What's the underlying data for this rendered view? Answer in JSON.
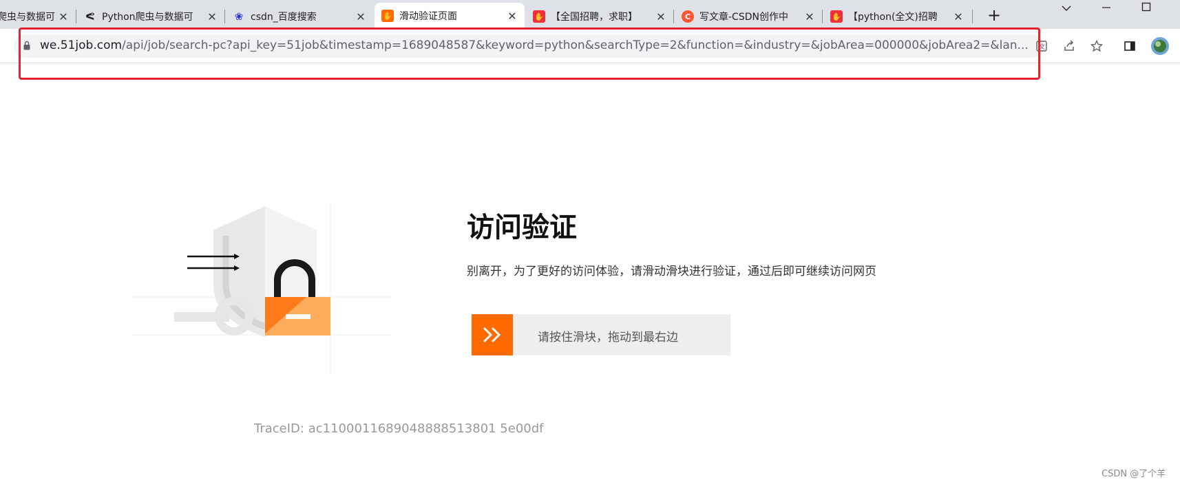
{
  "browser": {
    "tabs": [
      {
        "title": "爬虫与数据可",
        "icon": "app-icon",
        "active": false
      },
      {
        "title": "Python爬虫与数据可",
        "icon": "python-icon",
        "active": false
      },
      {
        "title": "csdn_百度搜索",
        "icon": "baidu-paw-icon",
        "active": false
      },
      {
        "title": "滑动验证页面",
        "icon": "hand-icon",
        "active": true
      },
      {
        "title": "【全国招聘，求职】",
        "icon": "51job-icon",
        "active": false
      },
      {
        "title": "写文章-CSDN创作中",
        "icon": "csdn-icon",
        "active": false
      },
      {
        "title": "【python(全文)招聘",
        "icon": "51job-icon",
        "active": false
      }
    ],
    "new_tab": "+",
    "close_glyph": "✕",
    "url_host": "we.51job.com",
    "url_path": "/api/job/search-pc?api_key=51job&timestamp=1689048587&keyword=python&searchType=2&function=&industry=&jobArea=000000&jobArea2=&lan..."
  },
  "page": {
    "title": "访问验证",
    "subtitle": "别离开，为了更好的访问体验，请滑动滑块进行验证，通过后即可继续访问网页",
    "slider_text": "请按住滑块，拖动到最右边",
    "trace_id": "TraceID: ac1100011689048888513801 5e00df",
    "watermark": "CSDN @了个羊"
  },
  "colors": {
    "accent": "#ff6a00",
    "highlight": "#e8222d",
    "lock_body": "#ffab5c"
  }
}
